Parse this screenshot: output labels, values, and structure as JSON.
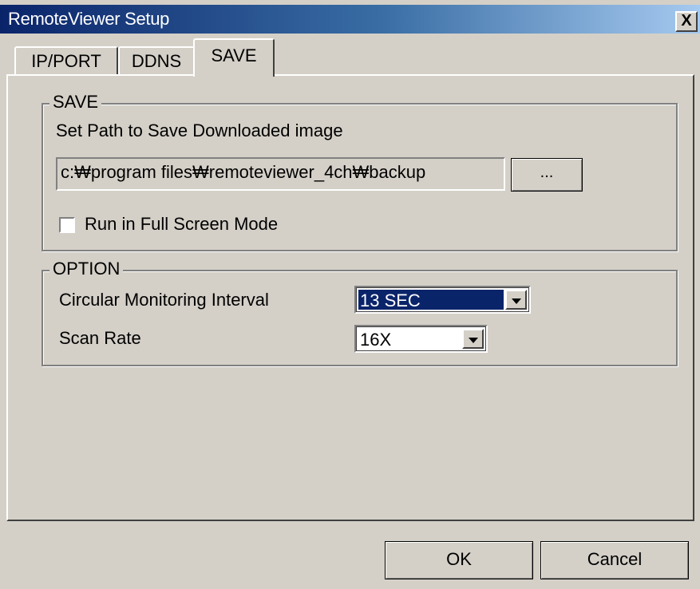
{
  "window": {
    "title": "RemoteViewer Setup",
    "close_label": "X"
  },
  "tabs": [
    {
      "label": "IP/PORT",
      "selected": false
    },
    {
      "label": "DDNS",
      "selected": false
    },
    {
      "label": "SAVE",
      "selected": true
    }
  ],
  "save_group": {
    "legend": "SAVE",
    "path_label": "Set Path to Save Downloaded image",
    "path_value": "c:₩program files₩remoteviewer_4ch₩backup",
    "browse_label": "...",
    "fullscreen_label": "Run in Full Screen Mode",
    "fullscreen_checked": false
  },
  "option_group": {
    "legend": "OPTION",
    "interval_label": "Circular Monitoring Interval",
    "interval_value": "13 SEC",
    "scan_label": "Scan Rate",
    "scan_value": "16X"
  },
  "buttons": {
    "ok": "OK",
    "cancel": "Cancel"
  },
  "colors": {
    "face": "#d4d0c8",
    "title_start": "#0a246a",
    "selection": "#0a246a"
  }
}
